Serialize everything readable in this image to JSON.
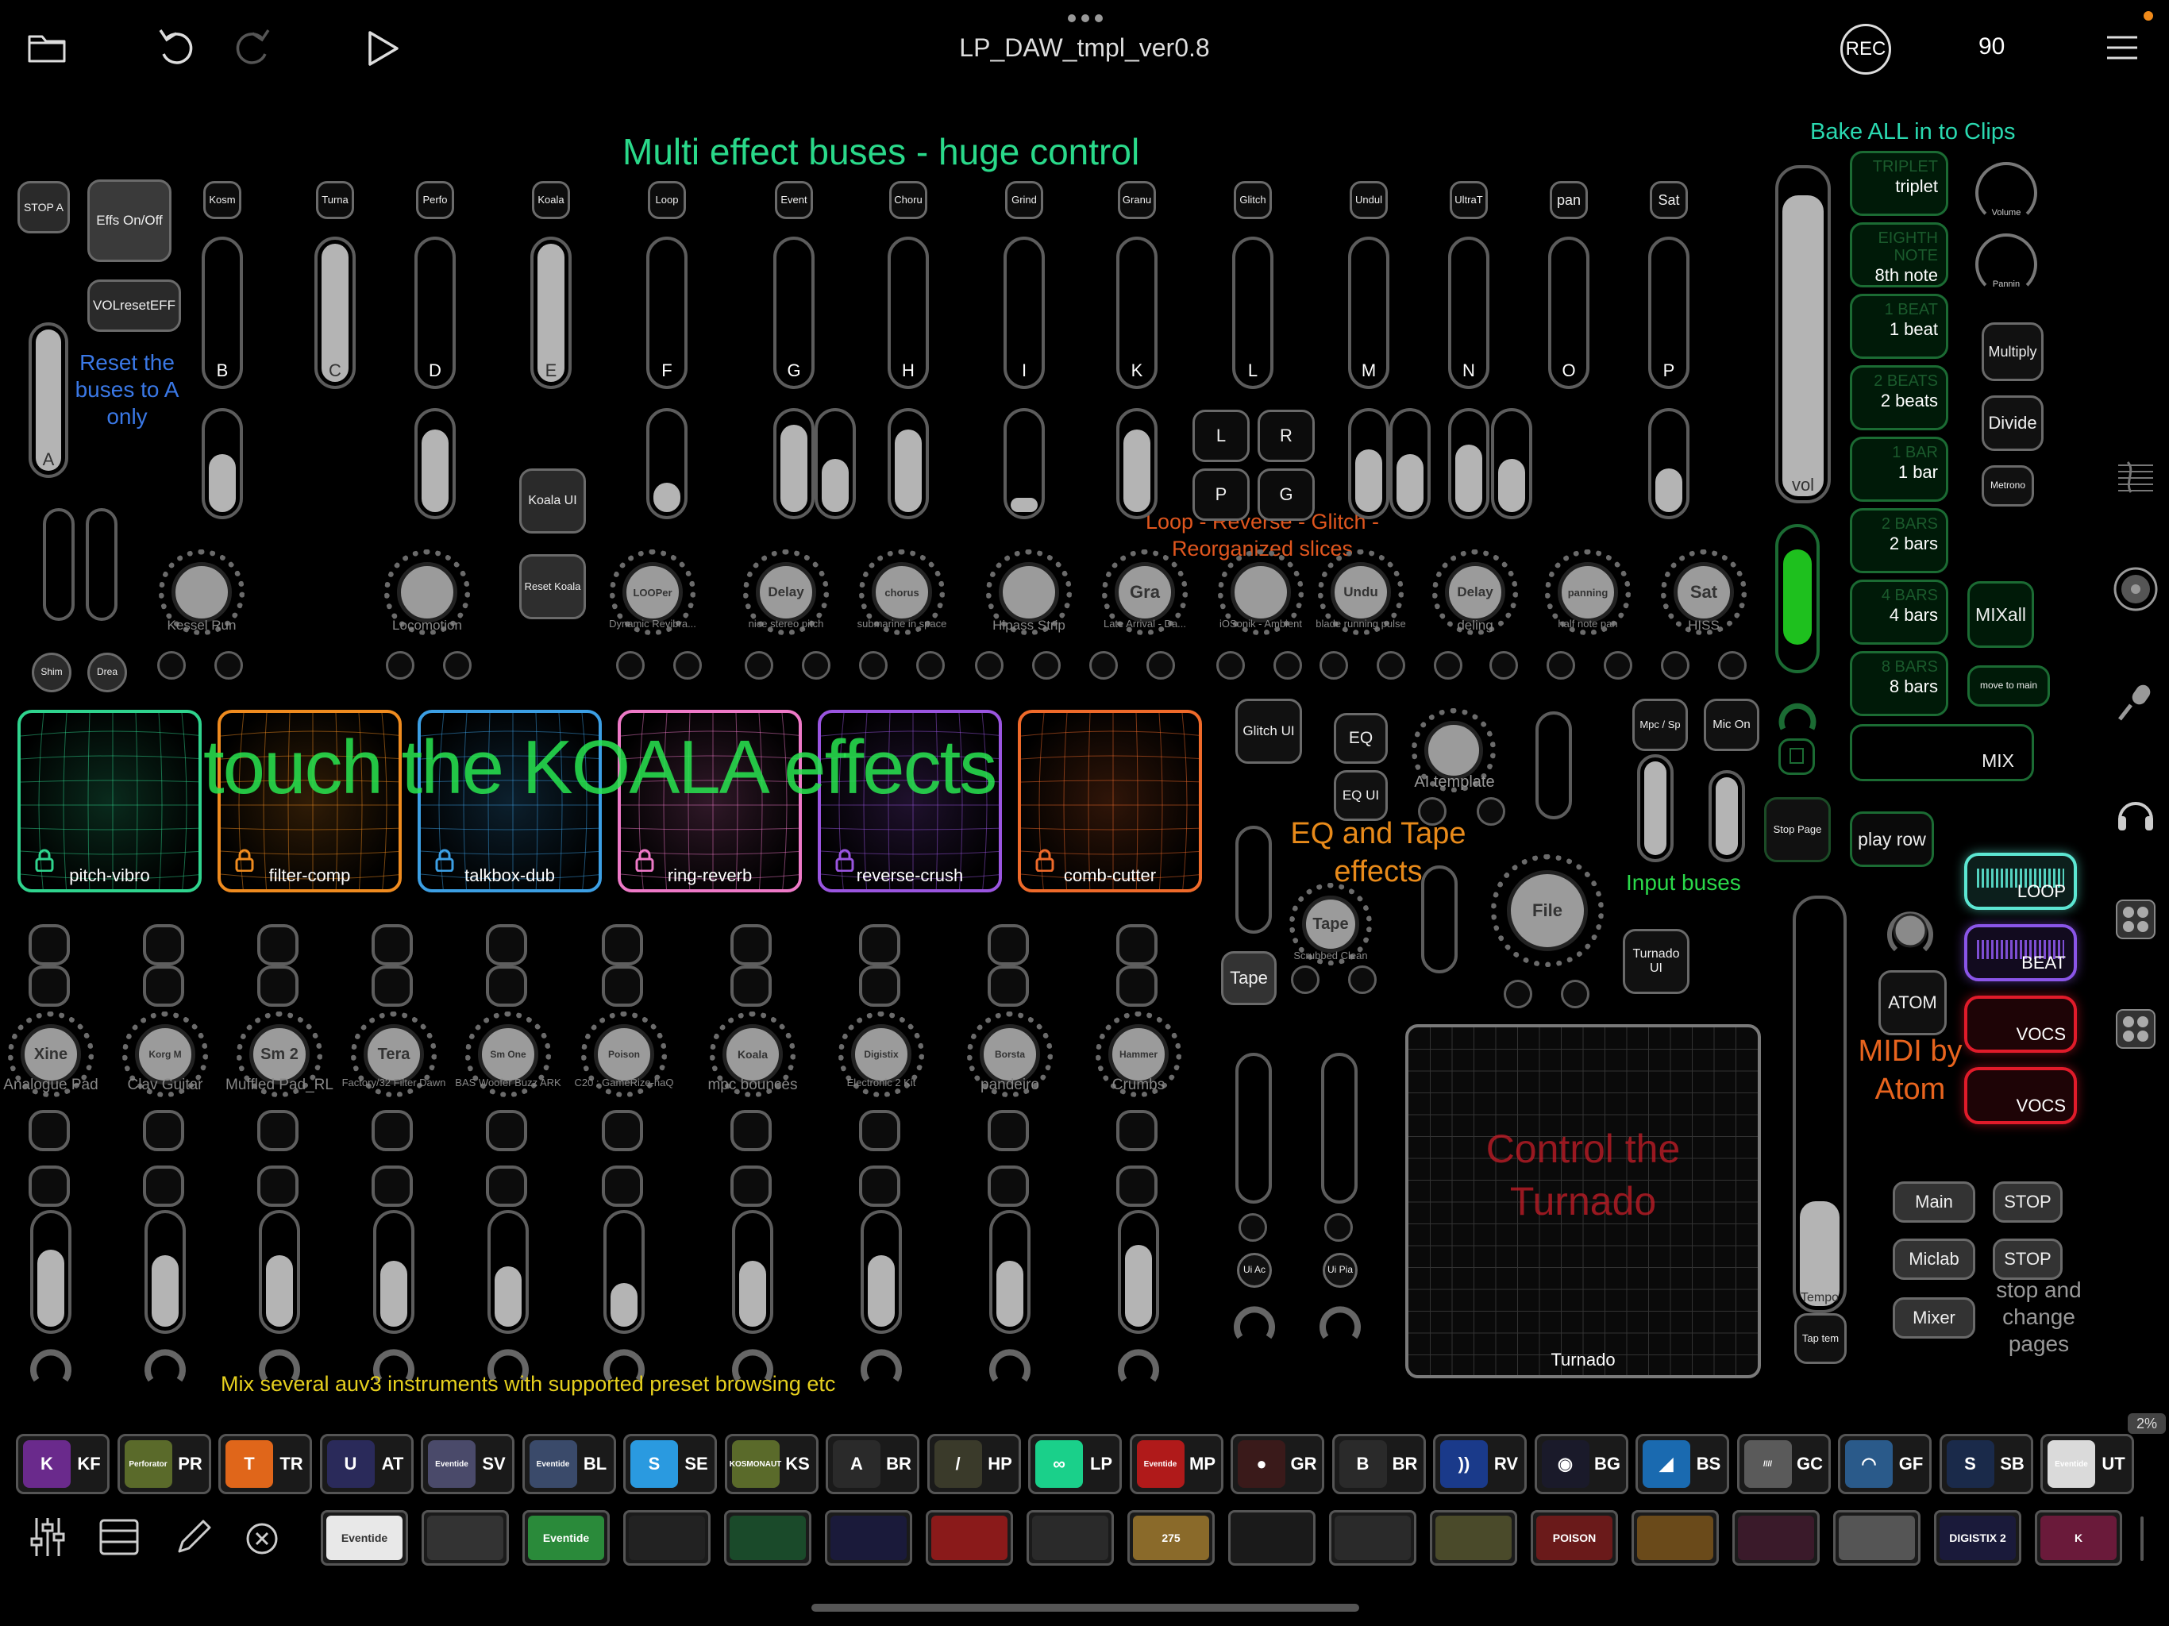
{
  "topbar": {
    "title": "LP_DAW_tmpl_ver0.8",
    "rec": "REC",
    "tempo_value": "90"
  },
  "headings": {
    "multi_effect": "Multi effect buses - huge control",
    "bake_all": "Bake ALL in to Clips",
    "reset_note": "Reset the buses to A only",
    "loop_reverse": "Loop - Reverse - Glitch - Reorganized slices",
    "touch_koala": "touch the KOALA effects",
    "eq_tape": "EQ and Tape effects",
    "input_buses": "Input buses",
    "midi_atom": "MIDI by Atom",
    "control_turnado": "Control the Turnado",
    "mix_instruments": "Mix several auv3 instruments with supported preset browsing etc",
    "stop_change": "stop and change pages"
  },
  "left_controls": {
    "stop_a": "STOP A",
    "effs_onoff": "Effs On/Off",
    "vol_reset": "VOLresetEFF",
    "bus_a": "A",
    "shim": "Shim",
    "drea": "Drea"
  },
  "buses": [
    {
      "tag": "Kosm",
      "letter": "B",
      "level": 0.0
    },
    {
      "tag": "Turna",
      "letter": "C",
      "level": 1.0
    },
    {
      "tag": "Perfo",
      "letter": "D",
      "level": 0.0
    },
    {
      "tag": "Koala",
      "letter": "E",
      "level": 1.0
    },
    {
      "tag": "Loop",
      "letter": "F",
      "level": 0.0
    },
    {
      "tag": "Event",
      "letter": "G",
      "level": 0.0
    },
    {
      "tag": "Choru",
      "letter": "H",
      "level": 0.0
    },
    {
      "tag": "Grind",
      "letter": "I",
      "level": 0.0
    },
    {
      "tag": "Granu",
      "letter": "K",
      "level": 0.0
    },
    {
      "tag": "Glitch",
      "letter": "L",
      "level": 0.0
    },
    {
      "tag": "Undul",
      "letter": "M",
      "level": 0.0
    },
    {
      "tag": "UltraT",
      "letter": "N",
      "level": 0.0
    },
    {
      "tag": "pan",
      "letter": "O",
      "level": 0.0
    },
    {
      "tag": "Sat",
      "letter": "P",
      "level": 0.0
    }
  ],
  "mid_buttons": {
    "koala_ui": "Koala UI",
    "reset_koala": "Reset Koala",
    "lrpg": [
      "L",
      "R",
      "P",
      "G"
    ]
  },
  "fx_knobs": [
    {
      "face": "",
      "caption": "Kessel Run"
    },
    {
      "face": "",
      "caption": "Locomotion"
    },
    {
      "face": "LOOPer",
      "caption": "Dynamic Revibra..."
    },
    {
      "face": "Delay",
      "caption": "nice stereo pitch"
    },
    {
      "face": "chorus",
      "caption": "submarine in space"
    },
    {
      "face": "",
      "caption": "Hipass Strip"
    },
    {
      "face": "Gra",
      "caption": "Late Arrival - Da..."
    },
    {
      "face": "",
      "caption": "iOSonik - Ambient"
    },
    {
      "face": "Undu",
      "caption": "blade running pulse"
    },
    {
      "face": "Delay",
      "caption": "deling"
    },
    {
      "face": "panning",
      "caption": "half note pan"
    },
    {
      "face": "Sat",
      "caption": "HISS"
    }
  ],
  "koala_pads": [
    {
      "name": "pitch-vibro",
      "color": "#2fd48e"
    },
    {
      "name": "filter-comp",
      "color": "#ef8b1f"
    },
    {
      "name": "talkbox-dub",
      "color": "#3c9fe4"
    },
    {
      "name": "ring-reverb",
      "color": "#ee79c7"
    },
    {
      "name": "reverse-crush",
      "color": "#9a55e0"
    },
    {
      "name": "comb-cutter",
      "color": "#ef6a2a"
    }
  ],
  "instruments": [
    {
      "face": "Xine",
      "caption": "Analogue Pad",
      "level": 0.7
    },
    {
      "face": "Korg M",
      "caption": "Clav Guitar",
      "level": 0.65
    },
    {
      "face": "Sm 2",
      "caption": "Muffled Pad_RL",
      "level": 0.65
    },
    {
      "face": "Tera",
      "caption": "Factory/32 Filter Dawn",
      "level": 0.6
    },
    {
      "face": "Sm One",
      "caption": "BAS Woofer Buzz ARK",
      "level": 0.55
    },
    {
      "face": "Poison",
      "caption": "C20 : GameRize-haQ",
      "level": 0.4
    },
    {
      "face": "Koala",
      "caption": "mpc bounces",
      "level": 0.6
    },
    {
      "face": "Digistix",
      "caption": "Electronic 2 Kit",
      "level": 0.65
    },
    {
      "face": "Borsta",
      "caption": "pandeiro",
      "level": 0.6
    },
    {
      "face": "Hammer",
      "caption": "Crumbs",
      "level": 0.75
    }
  ],
  "eq_section": {
    "glitch_ui": "Glitch UI",
    "eq": "EQ",
    "eq_ui": "EQ UI",
    "ai_template": "AI template",
    "tape_knob": "Tape",
    "tape_caption": "Scrubbed Clean",
    "tape_btn": "Tape",
    "file_knob": "File",
    "ui_ac": "Ui Ac",
    "ui_pia": "Ui Pia"
  },
  "input_section": {
    "mpc_sp": "Mpc / Sp",
    "mic_on": "Mic On",
    "turnado_ui": "Turnado UI",
    "turnado_label": "Turnado"
  },
  "right_column": {
    "vol_label": "vol",
    "stop_page": "Stop Page",
    "tempo_label": "Tempo",
    "tap_tempo": "Tap tem",
    "play_row": "play row"
  },
  "bake_buttons": [
    {
      "ghost": "TRIPLET",
      "label": "triplet"
    },
    {
      "ghost": "EIGHTH NOTE",
      "label": "8th note"
    },
    {
      "ghost": "1 BEAT",
      "label": "1 beat"
    },
    {
      "ghost": "2 BEATS",
      "label": "2 beats"
    },
    {
      "ghost": "1 BAR",
      "label": "1 bar"
    },
    {
      "ghost": "2 BARS",
      "label": "2 bars"
    },
    {
      "ghost": "4 BARS",
      "label": "4 bars"
    },
    {
      "ghost": "8 BARS",
      "label": "8 bars"
    }
  ],
  "right_knobs": {
    "volume": "Volume",
    "pannin": "Pannin"
  },
  "right_buttons": {
    "multiply": "Multiply",
    "divide": "Divide",
    "metrono": "Metrono",
    "mixall": "MIXall",
    "move_to_main": "move to main",
    "mix": "MIX"
  },
  "clips": [
    {
      "label": "LOOP",
      "color": "#5ce6d2"
    },
    {
      "label": "BEAT",
      "color": "#8a55e8"
    },
    {
      "label": "VOCS",
      "color": "#e01b2a"
    },
    {
      "label": "VOCS",
      "color": "#e01b2a"
    }
  ],
  "atom_btn": "ATOM",
  "page_buttons": {
    "main": "Main",
    "stop1": "STOP",
    "miclab": "Miclab",
    "stop2": "STOP",
    "mixer": "Mixer"
  },
  "battery": "2%",
  "app_strip": [
    {
      "abbr": "KF",
      "icon": "K",
      "color": "#6a2a8c"
    },
    {
      "abbr": "PR",
      "icon": "Perforator",
      "color": "#5a6a2a"
    },
    {
      "abbr": "TR",
      "icon": "T",
      "color": "#e0661a"
    },
    {
      "abbr": "AT",
      "icon": "U",
      "color": "#2a2a5a"
    },
    {
      "abbr": "SV",
      "icon": "Eventide",
      "color": "#4a4a6a"
    },
    {
      "abbr": "BL",
      "icon": "Eventide",
      "color": "#3a4a6a"
    },
    {
      "abbr": "SE",
      "icon": "S",
      "color": "#2a9ae0"
    },
    {
      "abbr": "KS",
      "icon": "KOSMONAUT",
      "color": "#5a6a2a"
    },
    {
      "abbr": "BR",
      "icon": "A",
      "color": "#2a2a2a"
    },
    {
      "abbr": "HP",
      "icon": "/",
      "color": "#3a3a2a"
    },
    {
      "abbr": "LP",
      "icon": "∞",
      "color": "#1ad08a"
    },
    {
      "abbr": "MP",
      "icon": "Eventide",
      "color": "#b01a1a"
    },
    {
      "abbr": "GR",
      "icon": "●",
      "color": "#3a1a1a"
    },
    {
      "abbr": "BR",
      "icon": "B",
      "color": "#2a2a2a"
    },
    {
      "abbr": "RV",
      "icon": "))",
      "color": "#1a3a8a"
    },
    {
      "abbr": "BG",
      "icon": "◉",
      "color": "#1a1a2a"
    },
    {
      "abbr": "BS",
      "icon": "◢",
      "color": "#1a6ab0"
    },
    {
      "abbr": "GC",
      "icon": "////",
      "color": "#5a5a5a"
    },
    {
      "abbr": "GF",
      "icon": "◠",
      "color": "#2a5a8a"
    },
    {
      "abbr": "SB",
      "icon": "S",
      "color": "#1a2a4a"
    },
    {
      "abbr": "UT",
      "icon": "Eventide",
      "color": "#dadada"
    }
  ],
  "dock": [
    "Eventide",
    "",
    "Eventide",
    "",
    "",
    "",
    "",
    "",
    "275",
    "",
    "",
    "",
    "POISON",
    "",
    "",
    "",
    "DIGISTIX 2",
    "K"
  ]
}
